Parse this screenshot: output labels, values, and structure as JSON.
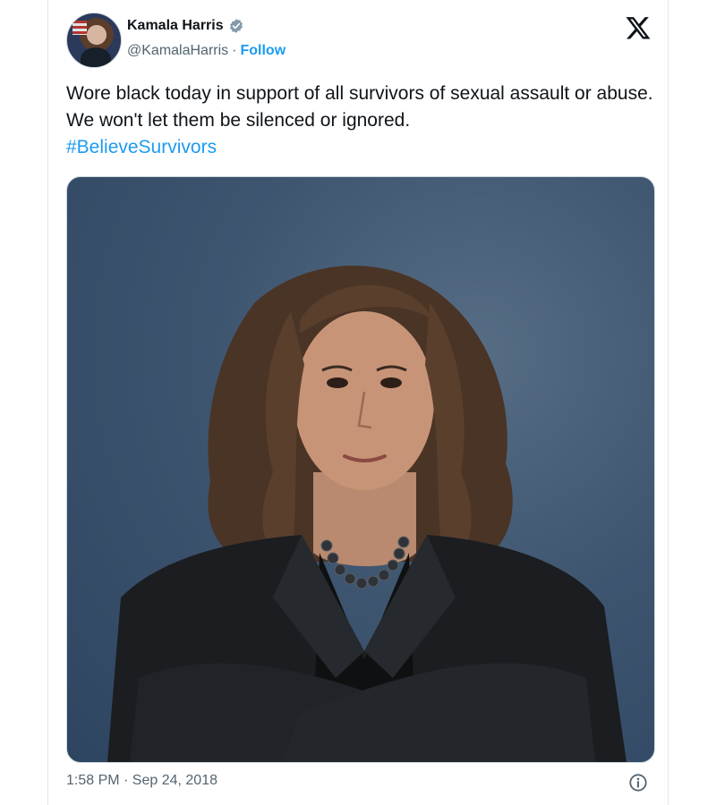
{
  "tweet": {
    "author": {
      "display_name": "Kamala Harris",
      "handle": "@KamalaHarris",
      "separator": "·",
      "follow_label": "Follow",
      "verified": true
    },
    "text_line": "Wore black today in support of all survivors of sexual assault or abuse. We won't let them be silenced or ignored.",
    "hashtag": "#BelieveSurvivors",
    "timestamp": "1:58 PM · Sep 24, 2018",
    "platform_icon": "x-logo-icon",
    "media_icon": "photo-portrait"
  },
  "colors": {
    "accent": "#1d9bf0",
    "text_primary": "#0f1419",
    "text_secondary": "#536471",
    "verified_badge": "#829aab"
  }
}
